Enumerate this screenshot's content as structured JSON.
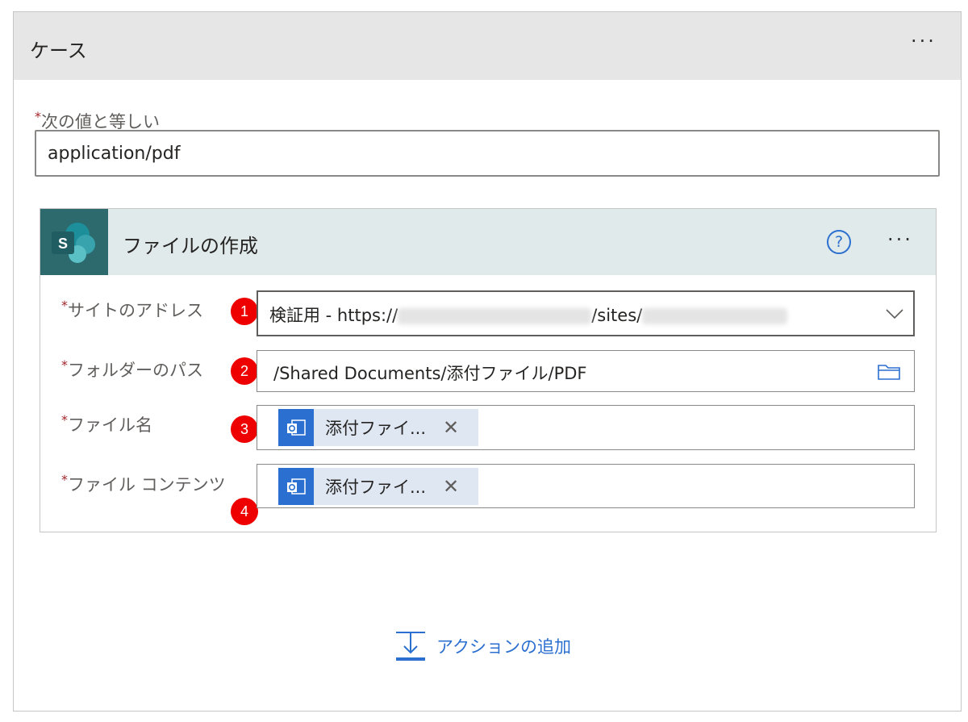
{
  "case": {
    "title": "ケース",
    "more": "···"
  },
  "equals": {
    "label": "次の値と等しい",
    "value": "application/pdf"
  },
  "action": {
    "title": "ファイルの作成",
    "help": "?",
    "more": "···",
    "logo_letter": "S",
    "fields": [
      {
        "label": "サイトのアドレス",
        "badge": "1",
        "value_prefix": "検証用 - https://",
        "value_mid": "/sites/"
      },
      {
        "label": "フォルダーのパス",
        "badge": "2",
        "value": "/Shared Documents/添付ファイル/PDF"
      },
      {
        "label": "ファイル名",
        "badge": "3",
        "token": "添付ファイ..."
      },
      {
        "label": "ファイル コンテンツ",
        "badge": "4",
        "token": "添付ファイ..."
      }
    ]
  },
  "add_action": {
    "label": "アクションの追加"
  },
  "colors": {
    "accent": "#2b6fd0",
    "sharepoint": "#2d6a6e",
    "badge": "#e00000"
  }
}
